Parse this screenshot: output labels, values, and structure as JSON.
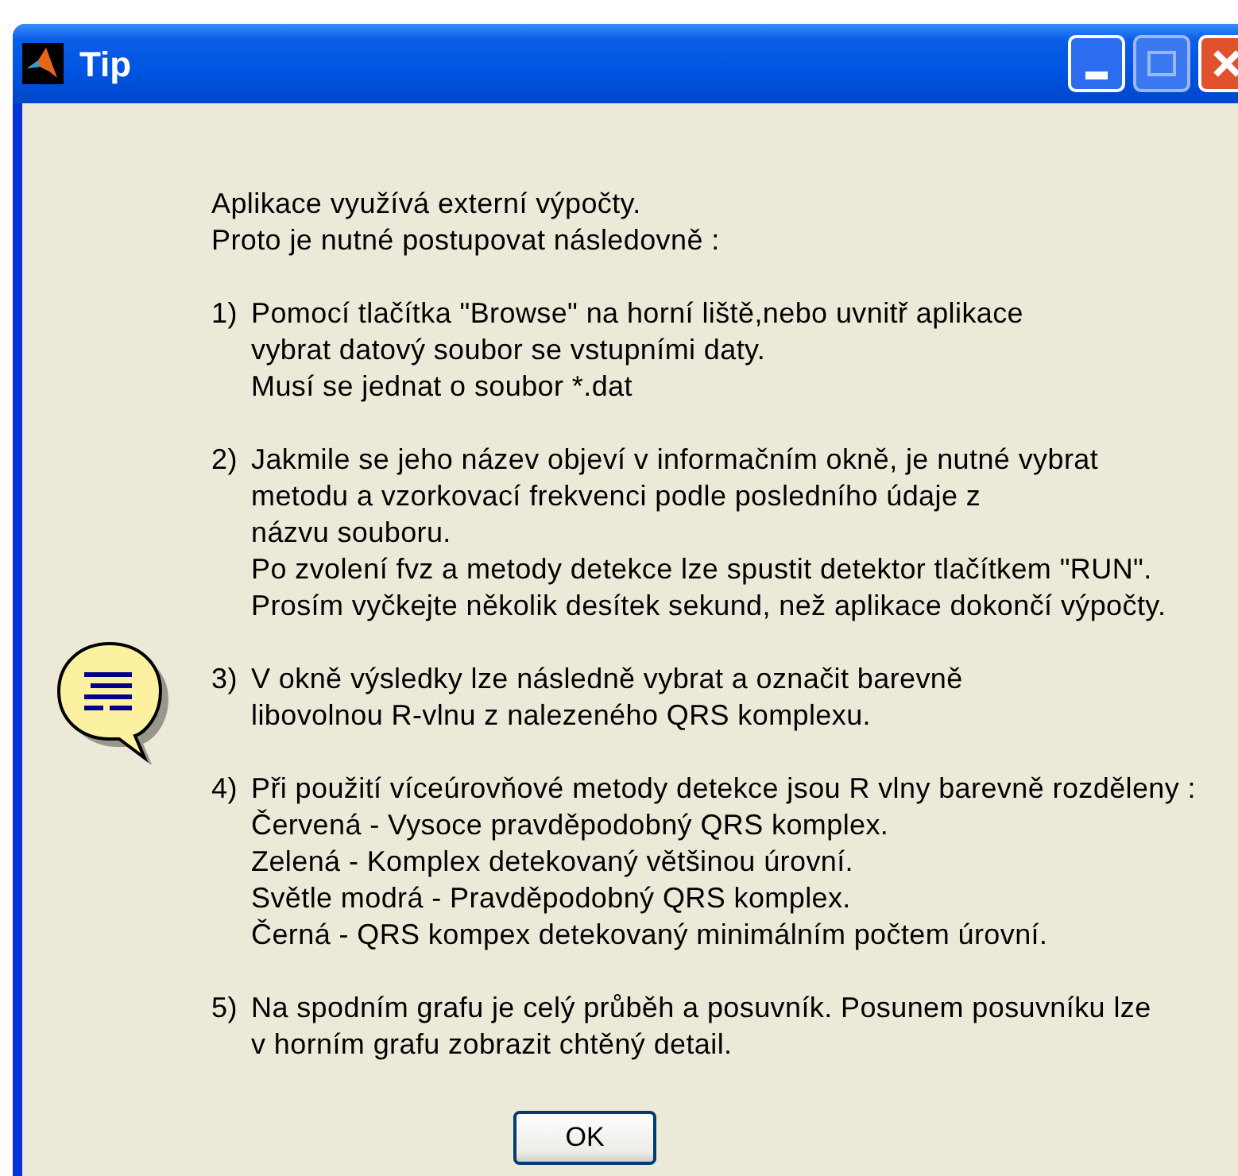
{
  "window": {
    "title": "Tip"
  },
  "paragraphs": [
    {
      "lines": [
        "Aplikace využívá externí výpočty.",
        "Proto je nutné postupovat následovně :"
      ]
    },
    {
      "number": "1)",
      "lines": [
        "Pomocí tlačítka \"Browse\" na horní liště,nebo uvnitř aplikace",
        "vybrat datový soubor se vstupními daty.",
        "Musí se jednat o soubor *.dat"
      ]
    },
    {
      "number": "2)",
      "lines": [
        "Jakmile se jeho název objeví v informačním okně, je nutné vybrat",
        "metodu a vzorkovací frekvenci podle posledního údaje z",
        "názvu souboru.",
        "Po zvolení fvz a metody detekce lze spustit detektor tlačítkem \"RUN\".",
        "Prosím vyčkejte několik desítek sekund, než aplikace dokončí výpočty."
      ]
    },
    {
      "number": "3)",
      "lines": [
        "V okně výsledky lze následně vybrat a označit barevně",
        "libovolnou R-vlnu z nalezeného QRS komplexu."
      ]
    },
    {
      "number": "4)",
      "lines": [
        "Při použití víceúrovňové metody detekce jsou R vlny barevně rozděleny :",
        "Červená - Vysoce pravděpodobný QRS komplex.",
        "Zelená - Komplex detekovaný většinou úrovní.",
        "Světle modrá - Pravděpodobný QRS komplex.",
        "Černá - QRS kompex detekovaný minimálním počtem úrovní."
      ]
    },
    {
      "number": "5)",
      "lines": [
        "Na spodním grafu je celý průběh a posuvník. Posunem posuvníku lze",
        "v horním grafu zobrazit chtěný detail."
      ]
    }
  ],
  "buttons": [
    "OK"
  ]
}
